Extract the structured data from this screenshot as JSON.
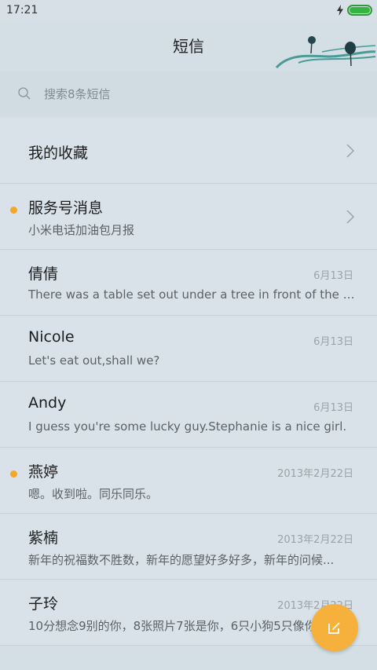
{
  "status_bar": {
    "time": "17:21"
  },
  "header": {
    "title": "短信"
  },
  "search": {
    "placeholder": "搜索8条短信"
  },
  "conversations": [
    {
      "name": "我的收藏",
      "preview": "",
      "date": "",
      "unread": false,
      "chevron": true
    },
    {
      "name": "服务号消息",
      "preview": "小米电话加油包月报",
      "date": "",
      "unread": true,
      "chevron": true
    },
    {
      "name": "倩倩",
      "preview": "There was a table set out under a tree in front of the ho...",
      "date": "6月13日",
      "unread": false,
      "chevron": false
    },
    {
      "name": "Nicole",
      "preview": "Let's eat out,shall we?",
      "date": "6月13日",
      "unread": false,
      "chevron": false
    },
    {
      "name": "Andy",
      "preview": "I guess you're some lucky guy.Stephanie is a nice girl.",
      "date": "6月13日",
      "unread": false,
      "chevron": false
    },
    {
      "name": "燕婷",
      "preview": "嗯。收到啦。同乐同乐。",
      "date": "2013年2月22日",
      "unread": true,
      "chevron": false
    },
    {
      "name": "紫楠",
      "preview": "新年的祝福数不胜数，新年的愿望好多好多，新年的问候...",
      "date": "2013年2月22日",
      "unread": false,
      "chevron": false
    },
    {
      "name": "子玲",
      "preview": "10分想念9别的你，8张照片7张是你，6只小狗5只像你...",
      "date": "2013年2月22日",
      "unread": false,
      "chevron": false
    }
  ],
  "colors": {
    "accent": "#f5a623",
    "background": "#d3dee5",
    "battery": "#35b440"
  },
  "icons": {
    "search": "search-icon",
    "chevron": "chevron-right-icon",
    "compose": "compose-icon"
  }
}
